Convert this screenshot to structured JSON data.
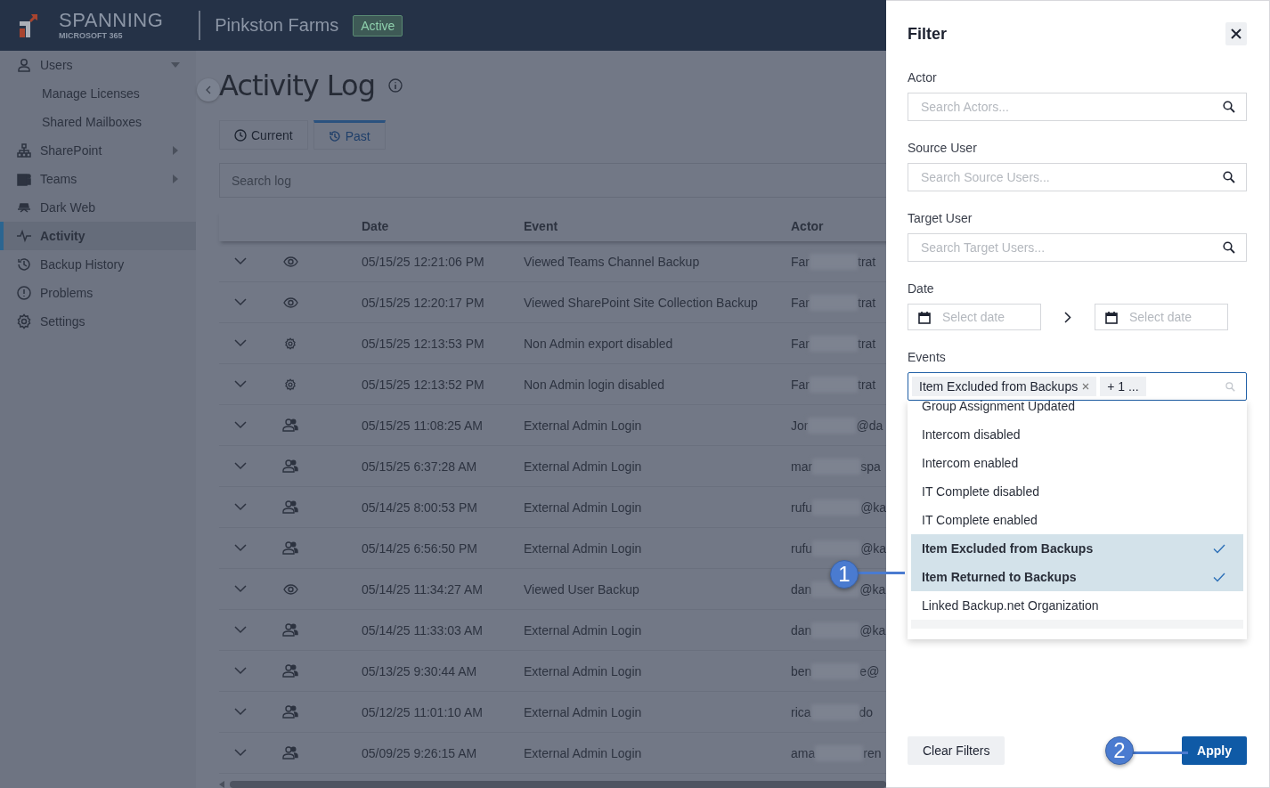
{
  "header": {
    "brand": "SPANNING",
    "brand_sub": "MICROSOFT 365",
    "tenant": "Pinkston Farms",
    "status": "Active"
  },
  "sidebar": {
    "items": [
      {
        "label": "Users",
        "kind": "section",
        "expanded": true,
        "selected": false
      },
      {
        "label": "Manage Licenses",
        "kind": "sub",
        "selected": false
      },
      {
        "label": "Shared Mailboxes",
        "kind": "sub",
        "selected": false
      },
      {
        "label": "SharePoint",
        "kind": "section",
        "expanded": false,
        "selected": false
      },
      {
        "label": "Teams",
        "kind": "section",
        "expanded": false,
        "selected": false
      },
      {
        "label": "Dark Web",
        "kind": "section",
        "selected": false
      },
      {
        "label": "Activity",
        "kind": "section",
        "selected": true
      },
      {
        "label": "Backup History",
        "kind": "section",
        "selected": false
      },
      {
        "label": "Problems",
        "kind": "section",
        "selected": false
      },
      {
        "label": "Settings",
        "kind": "section",
        "selected": false
      }
    ]
  },
  "page": {
    "title": "Activity Log",
    "tabs": [
      {
        "label": "Current",
        "selected": false
      },
      {
        "label": "Past",
        "selected": true
      }
    ],
    "search": {
      "placeholder": "Search log"
    },
    "table": {
      "columns": [
        "Date",
        "Event",
        "Actor"
      ],
      "rows": [
        {
          "kind": "view",
          "date": "05/15/25 12:21:06 PM",
          "event": "Viewed Teams Channel Backup",
          "actor_start": "Far",
          "actor_end": "trat"
        },
        {
          "kind": "view",
          "date": "05/15/25 12:20:17 PM",
          "event": "Viewed SharePoint Site Collection Backup",
          "actor_start": "Far",
          "actor_end": "trat"
        },
        {
          "kind": "settings",
          "date": "05/15/25 12:13:53 PM",
          "event": "Non Admin export disabled",
          "actor_start": "Far",
          "actor_end": "trat"
        },
        {
          "kind": "settings",
          "date": "05/15/25 12:13:52 PM",
          "event": "Non Admin login disabled",
          "actor_start": "Far",
          "actor_end": "trat"
        },
        {
          "kind": "login",
          "date": "05/15/25 11:08:25 AM",
          "event": "External Admin Login",
          "actor_start": "Jor",
          "actor_end": "@da"
        },
        {
          "kind": "login",
          "date": "05/15/25 6:37:28 AM",
          "event": "External Admin Login",
          "actor_start": "mar",
          "actor_end": "spa"
        },
        {
          "kind": "login",
          "date": "05/14/25 8:00:53 PM",
          "event": "External Admin Login",
          "actor_start": "rufu",
          "actor_end": "@ka"
        },
        {
          "kind": "login",
          "date": "05/14/25 6:56:50 PM",
          "event": "External Admin Login",
          "actor_start": "rufu",
          "actor_end": "@ka"
        },
        {
          "kind": "view",
          "date": "05/14/25 11:34:27 AM",
          "event": "Viewed User Backup",
          "actor_start": "dan",
          "actor_end": "@ka"
        },
        {
          "kind": "login",
          "date": "05/14/25 11:33:03 AM",
          "event": "External Admin Login",
          "actor_start": "dan",
          "actor_end": "@ka"
        },
        {
          "kind": "login",
          "date": "05/13/25 9:30:44 AM",
          "event": "External Admin Login",
          "actor_start": "ben",
          "actor_end": "e@"
        },
        {
          "kind": "login",
          "date": "05/12/25 11:01:10 AM",
          "event": "External Admin Login",
          "actor_start": "rica",
          "actor_end": "do"
        },
        {
          "kind": "login",
          "date": "05/09/25 9:26:15 AM",
          "event": "External Admin Login",
          "actor_start": "ama",
          "actor_end": "ren"
        }
      ]
    }
  },
  "filter": {
    "title": "Filter",
    "fields": [
      {
        "label": "Actor",
        "placeholder": "Search Actors..."
      },
      {
        "label": "Source User",
        "placeholder": "Search Source Users..."
      },
      {
        "label": "Target User",
        "placeholder": "Search Target Users..."
      }
    ],
    "date": {
      "label": "Date",
      "start_placeholder": "Select date",
      "end_placeholder": "Select date"
    },
    "events": {
      "label": "Events",
      "tags": [
        "Item Excluded from Backups"
      ],
      "more": "+ 1 ...",
      "options": [
        {
          "label": "Group Assignment Updated",
          "selected": false
        },
        {
          "label": "Intercom disabled",
          "selected": false
        },
        {
          "label": "Intercom enabled",
          "selected": false
        },
        {
          "label": "IT Complete disabled",
          "selected": false
        },
        {
          "label": "IT Complete enabled",
          "selected": false
        },
        {
          "label": "Item Excluded from Backups",
          "selected": true
        },
        {
          "label": "Item Returned to Backups",
          "selected": true
        },
        {
          "label": "Linked Backup.net Organization",
          "selected": false
        }
      ]
    },
    "buttons": {
      "clear": "Clear Filters",
      "apply": "Apply"
    }
  },
  "callouts": [
    "1",
    "2"
  ]
}
